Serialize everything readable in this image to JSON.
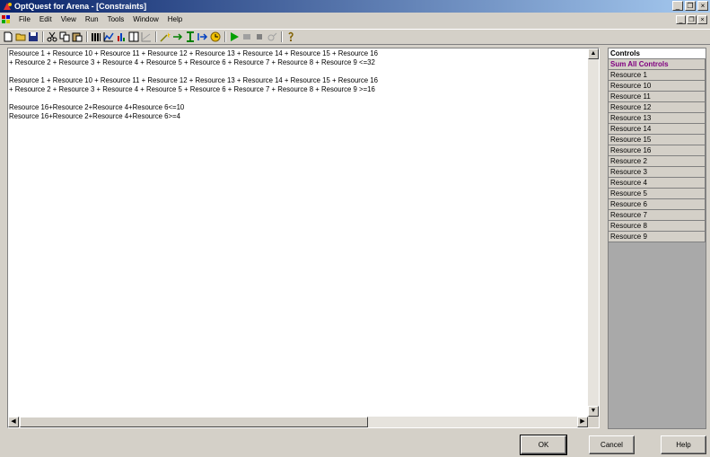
{
  "title": "OptQuest for Arena - [Constraints]",
  "menu": [
    "File",
    "Edit",
    "View",
    "Run",
    "Tools",
    "Window",
    "Help"
  ],
  "window_controls": {
    "minimize": "_",
    "restore": "❐",
    "close": "×"
  },
  "editor_lines": [
    "Resource 1 + Resource 10 + Resource 11 + Resource 12 + Resource 13 + Resource 14 + Resource 15 + Resource 16",
    " + Resource 2 + Resource 3 + Resource 4 + Resource 5 + Resource 6 + Resource 7 + Resource 8 + Resource 9 <=32",
    "",
    "Resource 1 + Resource 10 + Resource 11 + Resource 12 + Resource 13 + Resource 14 + Resource 15 + Resource 16",
    " + Resource 2 + Resource 3 + Resource 4 + Resource 5 + Resource 6 + Resource 7 + Resource 8 + Resource 9 >=16",
    "",
    "Resource 16+Resource 2+Resource 4+Resource 6<=10",
    "Resource 16+Resource 2+Resource 4+Resource 6>=4"
  ],
  "controls": {
    "header": "Controls",
    "sum_label": "Sum All Controls",
    "items": [
      "Resource 1",
      "Resource 10",
      "Resource 11",
      "Resource 12",
      "Resource 13",
      "Resource 14",
      "Resource 15",
      "Resource 16",
      "Resource 2",
      "Resource 3",
      "Resource 4",
      "Resource 5",
      "Resource 6",
      "Resource 7",
      "Resource 8",
      "Resource 9"
    ]
  },
  "buttons": {
    "ok": "OK",
    "cancel": "Cancel",
    "help": "Help"
  },
  "colors": {
    "titlebar_start": "#0a246a",
    "titlebar_end": "#a6caf0",
    "sum_text": "#800080"
  }
}
